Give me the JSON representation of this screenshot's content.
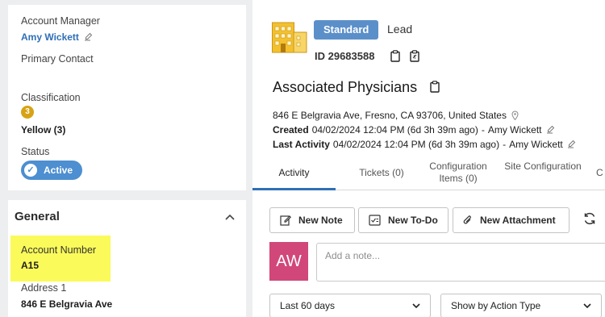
{
  "account": {
    "manager_label": "Account Manager",
    "manager_name": "Amy Wickett",
    "primary_contact_label": "Primary Contact",
    "classification_label": "Classification",
    "classification_number": "3",
    "classification_value": "Yellow (3)",
    "status_label": "Status",
    "status_value": "Active"
  },
  "general": {
    "title": "General",
    "account_number_label": "Account Number",
    "account_number_value": "A15",
    "address1_label": "Address 1",
    "address1_value": "846 E Belgravia Ave"
  },
  "header": {
    "badge": "Standard",
    "type": "Lead",
    "id_text": "ID 29683588",
    "company": "Associated Physicians",
    "address": "846 E Belgravia Ave, Fresno, CA 93706, United States",
    "created_label": "Created",
    "created_value": "04/02/2024 12:04 PM (6d 3h 39m ago)",
    "created_by": "Amy Wickett",
    "last_activity_label": "Last Activity",
    "last_activity_value": "04/02/2024 12:04 PM (6d 3h 39m ago)",
    "last_activity_by": "Amy Wickett"
  },
  "tabs": [
    {
      "label": "Activity"
    },
    {
      "label": "Tickets (0)"
    },
    {
      "label": "Configuration Items (0)"
    },
    {
      "label": "Site Configuration"
    }
  ],
  "actions": {
    "new_note": "New Note",
    "new_todo": "New To-Do",
    "new_attachment": "New Attachment"
  },
  "composer": {
    "avatar_initials": "AW",
    "placeholder": "Add a note..."
  },
  "filters": {
    "range": "Last 60 days",
    "show_by": "Show by Action Type"
  },
  "colors": {
    "accent": "#2f6fb6",
    "badge": "#5b8fc9",
    "avatar": "#d1477a",
    "classification": "#d7a315",
    "highlight": "#fafa5a"
  }
}
